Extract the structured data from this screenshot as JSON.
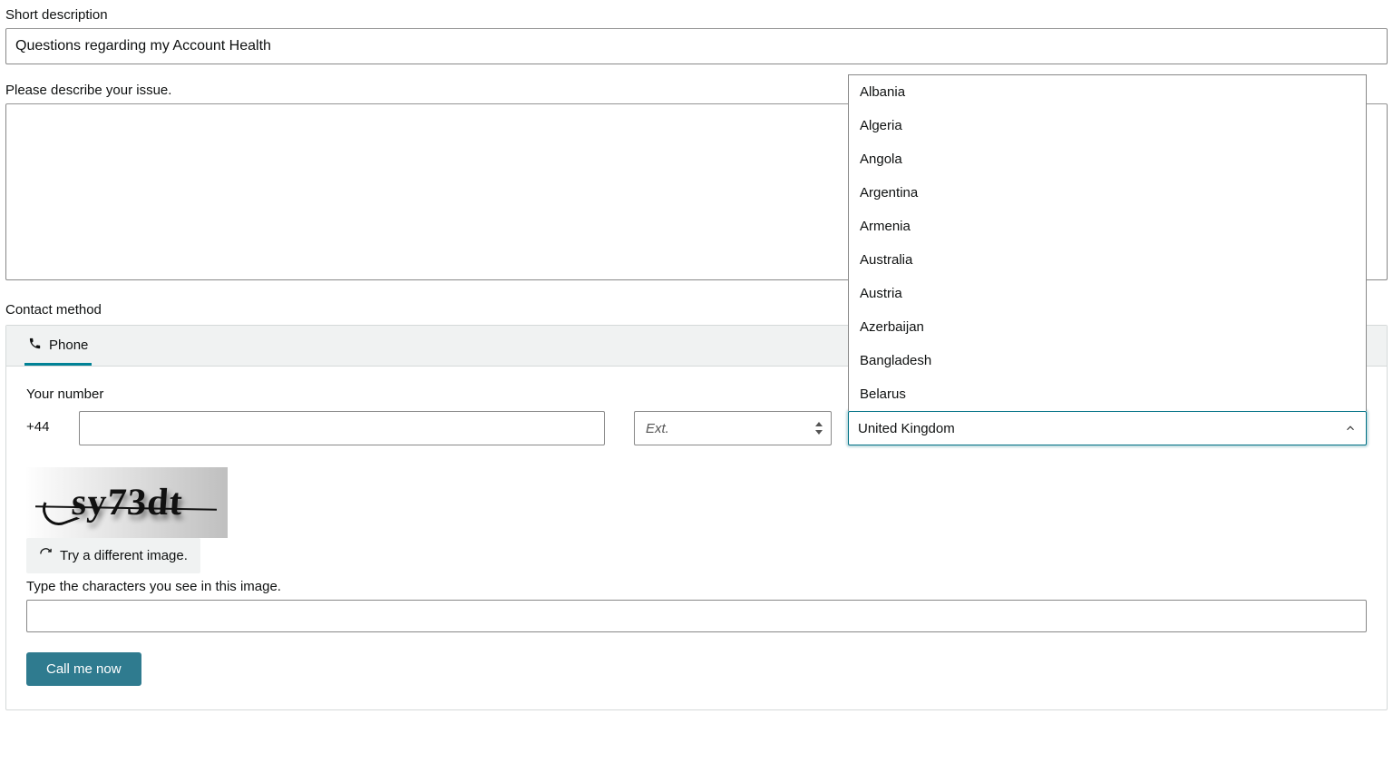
{
  "short_description": {
    "label": "Short description",
    "value": "Questions regarding my Account Health"
  },
  "describe": {
    "label": "Please describe your issue.",
    "value": ""
  },
  "contact": {
    "section_label": "Contact method",
    "tab_phone": "Phone",
    "your_number_label": "Your number",
    "dial_code": "+44",
    "phone_value": "",
    "ext_placeholder": "Ext.",
    "country_selected": "United Kingdom",
    "country_options": [
      "Albania",
      "Algeria",
      "Angola",
      "Argentina",
      "Armenia",
      "Australia",
      "Austria",
      "Azerbaijan",
      "Bangladesh",
      "Belarus"
    ]
  },
  "captcha": {
    "image_text": "sy73dt",
    "try_different": "Try a different image.",
    "instruction": "Type the characters you see in this image.",
    "input_value": ""
  },
  "call_button": "Call me now"
}
